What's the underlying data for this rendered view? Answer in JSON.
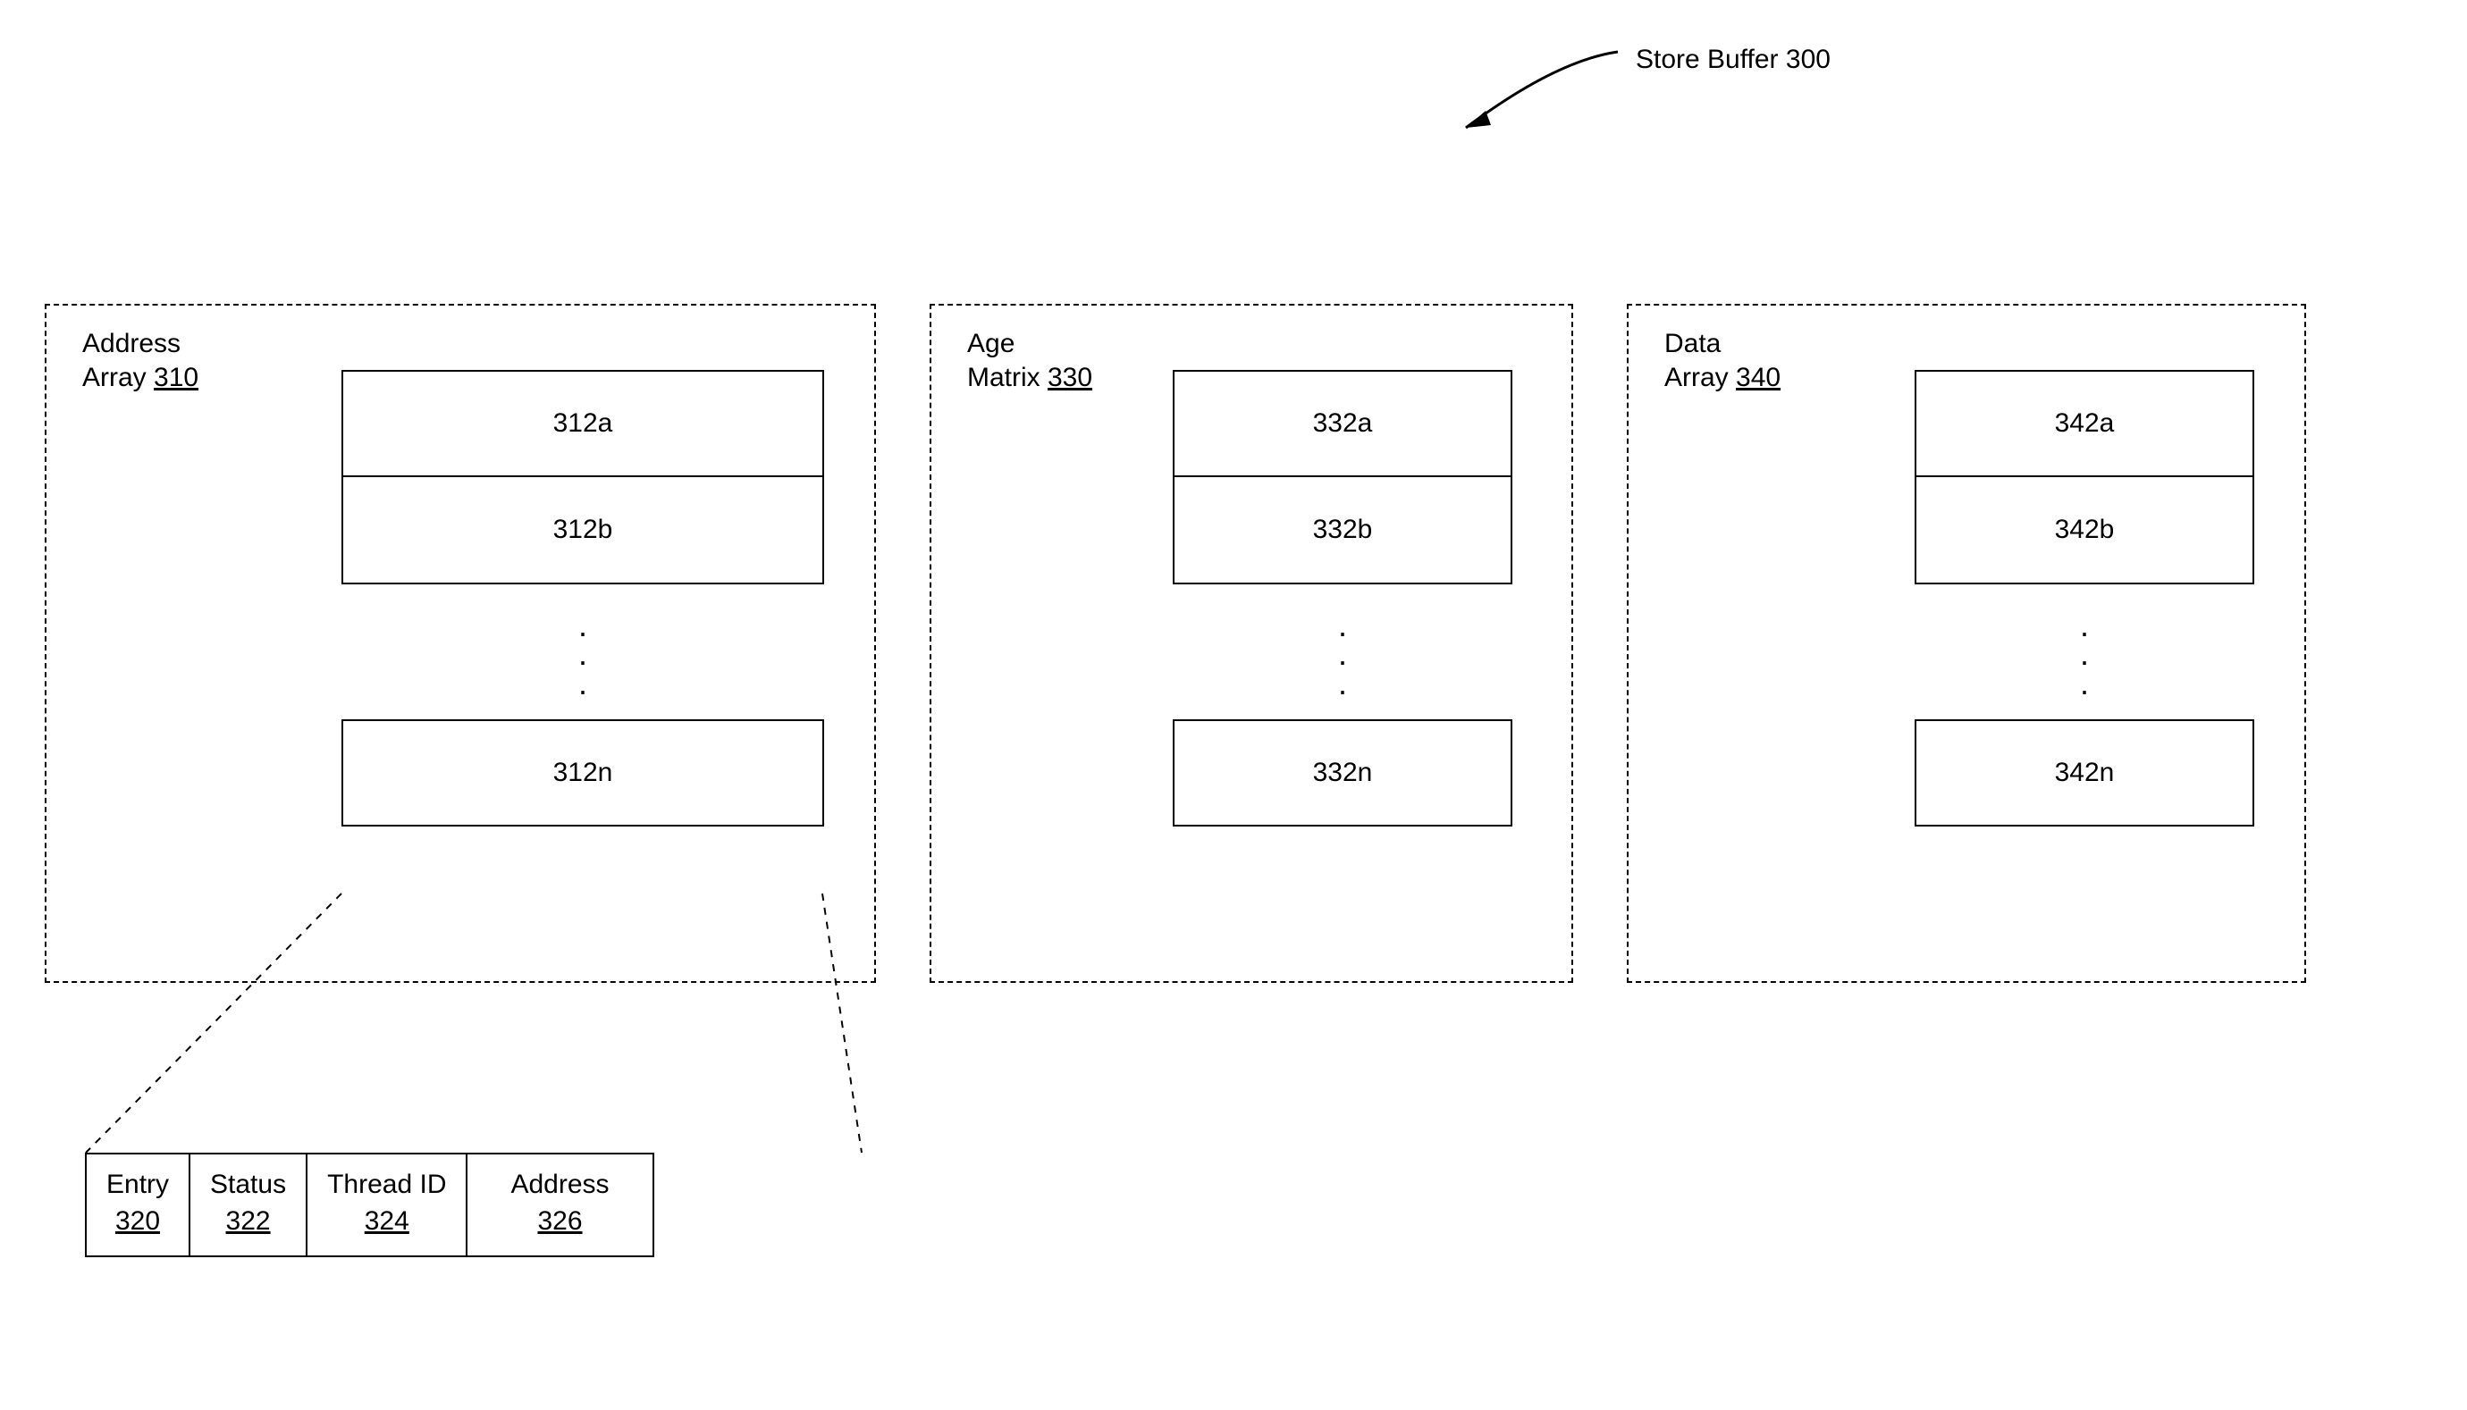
{
  "title": {
    "label": "Store Buffer",
    "ref": "300"
  },
  "panels": {
    "address": {
      "label": "Address\nArray",
      "ref": "310",
      "rows": [
        "312a",
        "312b",
        "312n"
      ]
    },
    "age": {
      "label": "Age\nMatrix",
      "ref": "330",
      "rows": [
        "332a",
        "332b",
        "332n"
      ]
    },
    "data": {
      "label": "Data\nArray",
      "ref": "340",
      "rows": [
        "342a",
        "342b",
        "342n"
      ]
    }
  },
  "detail": {
    "cells": [
      {
        "label": "Entry",
        "ref": "320"
      },
      {
        "label": "Status",
        "ref": "322"
      },
      {
        "label": "Thread ID",
        "ref": "324"
      },
      {
        "label": "Address",
        "ref": "326"
      }
    ]
  }
}
